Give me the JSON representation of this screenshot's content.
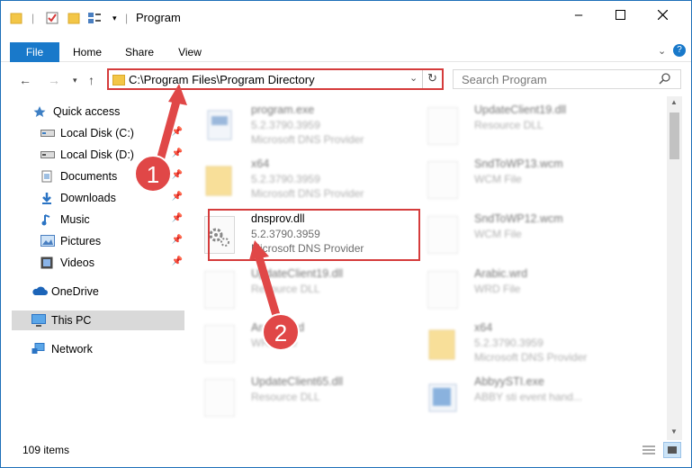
{
  "window": {
    "title": "Program",
    "accent": "#1979ca",
    "highlight": "#d53c3c"
  },
  "ribbon": {
    "tabs": [
      "File",
      "Home",
      "Share",
      "View"
    ]
  },
  "address": {
    "path": "C:\\Program Files\\Program Directory",
    "search_placeholder": "Search Program"
  },
  "nav": {
    "items": [
      {
        "label": "Quick access",
        "icon": "star-icon"
      },
      {
        "label": "Local Disk (C:)",
        "icon": "drive-icon",
        "pinned": true
      },
      {
        "label": "Local Disk (D:)",
        "icon": "drive-icon",
        "pinned": true
      },
      {
        "label": "Documents",
        "icon": "documents-icon",
        "pinned": true
      },
      {
        "label": "Downloads",
        "icon": "download-icon",
        "pinned": true
      },
      {
        "label": "Music",
        "icon": "music-icon",
        "pinned": true
      },
      {
        "label": "Pictures",
        "icon": "pictures-icon",
        "pinned": true
      },
      {
        "label": "Videos",
        "icon": "videos-icon",
        "pinned": true
      },
      {
        "label": "OneDrive",
        "icon": "cloud-icon"
      },
      {
        "label": "This PC",
        "icon": "pc-icon",
        "selected": true
      },
      {
        "label": "Network",
        "icon": "network-icon"
      }
    ]
  },
  "files": {
    "left": [
      {
        "name": "program.exe",
        "line2": "5.2.3790.3959",
        "line3": "Microsoft DNS Provider",
        "icon": "exe-icon"
      },
      {
        "name": "x64",
        "line2": "5.2.3790.3959",
        "line3": "Microsoft DNS Provider",
        "icon": "folder-icon"
      },
      {
        "name": "dnsprov.dll",
        "line2": "5.2.3790.3959",
        "line3": "Microsoft DNS Provider",
        "icon": "dll-gear-icon"
      },
      {
        "name": "UpdateClient19.dll",
        "line2": "Resource DLL",
        "line3": "",
        "icon": "dll-gear-icon"
      },
      {
        "name": "Arabic.wrd",
        "line2": "WRD File",
        "line3": "",
        "icon": "file-icon"
      },
      {
        "name": "UpdateClient65.dll",
        "line2": "Resource DLL",
        "line3": "",
        "icon": "dll-gear-icon"
      }
    ],
    "right": [
      {
        "name": "UpdateClient19.dll",
        "line2": "Resource DLL",
        "line3": "",
        "icon": "dll-gear-icon"
      },
      {
        "name": "SndToWP13.wcm",
        "line2": "WCM File",
        "line3": "",
        "icon": "file-icon"
      },
      {
        "name": "SndToWP12.wcm",
        "line2": "WCM File",
        "line3": "",
        "icon": "file-icon"
      },
      {
        "name": "Arabic.wrd",
        "line2": "WRD File",
        "line3": "",
        "icon": "file-icon"
      },
      {
        "name": "x64",
        "line2": "5.2.3790.3959",
        "line3": "Microsoft DNS Provider",
        "icon": "folder-icon"
      },
      {
        "name": "AbbyySTI.exe",
        "line2": "ABBY sti event hand...",
        "line3": "",
        "icon": "exe-icon"
      }
    ]
  },
  "status": {
    "count": "109 items"
  },
  "annotations": [
    "1",
    "2"
  ]
}
